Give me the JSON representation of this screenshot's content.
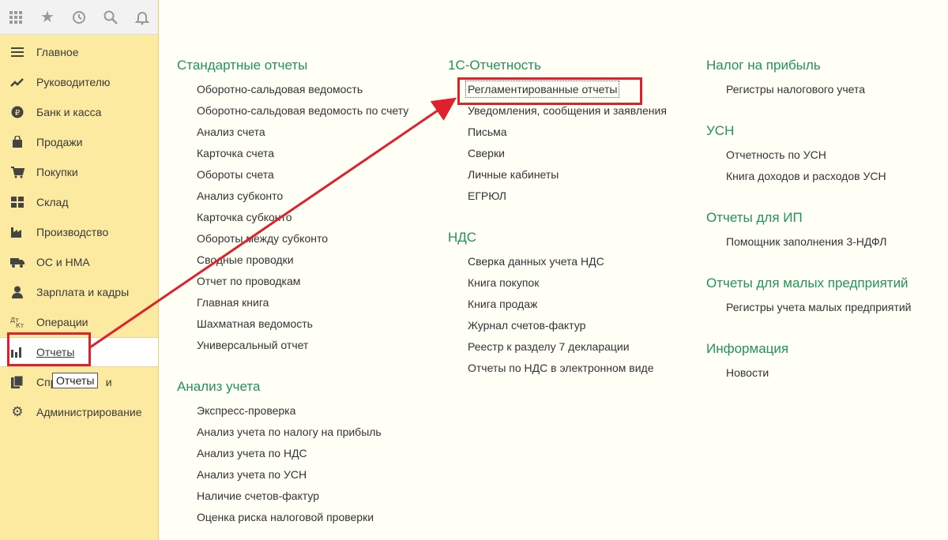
{
  "sidebar": {
    "toolbar_icons": [
      "apps-grid-icon",
      "star-icon",
      "history-icon",
      "search-icon",
      "bell-icon"
    ],
    "items": [
      {
        "label": "Главное",
        "icon": "menu-lines-icon"
      },
      {
        "label": "Руководителю",
        "icon": "trend-up-icon"
      },
      {
        "label": "Банк и касса",
        "icon": "ruble-coin-icon"
      },
      {
        "label": "Продажи",
        "icon": "shopping-bag-icon"
      },
      {
        "label": "Покупки",
        "icon": "cart-icon"
      },
      {
        "label": "Склад",
        "icon": "warehouse-icon"
      },
      {
        "label": "Производство",
        "icon": "factory-icon"
      },
      {
        "label": "ОС и НМА",
        "icon": "truck-icon"
      },
      {
        "label": "Зарплата и кадры",
        "icon": "person-icon"
      },
      {
        "label": "Операции",
        "icon": "dt-kt-icon"
      },
      {
        "label": "Отчеты",
        "icon": "bar-chart-icon",
        "active": true
      },
      {
        "label": "Справочники",
        "icon": "books-icon",
        "visible_text": "Спр                и"
      },
      {
        "label": "Администрирование",
        "icon": "gear-icon"
      }
    ],
    "tooltip": "Отчеты"
  },
  "columns": [
    {
      "sections": [
        {
          "title": "Стандартные отчеты",
          "items": [
            "Оборотно-сальдовая ведомость",
            "Оборотно-сальдовая ведомость по счету",
            "Анализ счета",
            "Карточка счета",
            "Обороты счета",
            "Анализ субконто",
            "Карточка субконто",
            "Обороты между субконто",
            "Сводные проводки",
            "Отчет по проводкам",
            "Главная книга",
            "Шахматная ведомость",
            "Универсальный отчет"
          ]
        },
        {
          "title": "Анализ учета",
          "items": [
            "Экспресс-проверка",
            "Анализ учета по налогу на прибыль",
            "Анализ учета по НДС",
            "Анализ учета по УСН",
            "Наличие счетов-фактур",
            "Оценка риска налоговой проверки"
          ]
        }
      ]
    },
    {
      "sections": [
        {
          "title": "1С-Отчетность",
          "items": [
            "Регламентированные отчеты",
            "Уведомления, сообщения и заявления",
            "Письма",
            "Сверки",
            "Личные кабинеты",
            "ЕГРЮЛ"
          ]
        },
        {
          "title": "НДС",
          "items": [
            "Сверка данных учета НДС",
            "Книга покупок",
            "Книга продаж",
            "Журнал счетов-фактур",
            "Реестр к разделу 7 декларации",
            "Отчеты по НДС в электронном виде"
          ]
        }
      ]
    },
    {
      "sections": [
        {
          "title": "Налог на прибыль",
          "items": [
            "Регистры налогового учета"
          ]
        },
        {
          "title": "УСН",
          "items": [
            "Отчетность по УСН",
            "Книга доходов и расходов УСН"
          ]
        },
        {
          "title": "Отчеты для ИП",
          "items": [
            "Помощник заполнения 3-НДФЛ"
          ]
        },
        {
          "title": "Отчеты для малых предприятий",
          "items": [
            "Регистры учета малых предприятий"
          ]
        },
        {
          "title": "Информация",
          "items": [
            "Новости"
          ]
        }
      ]
    }
  ],
  "colors": {
    "section_title": "#22935a",
    "sidebar_bg": "#fbeaa0",
    "annotation_red": "#e0202a"
  }
}
